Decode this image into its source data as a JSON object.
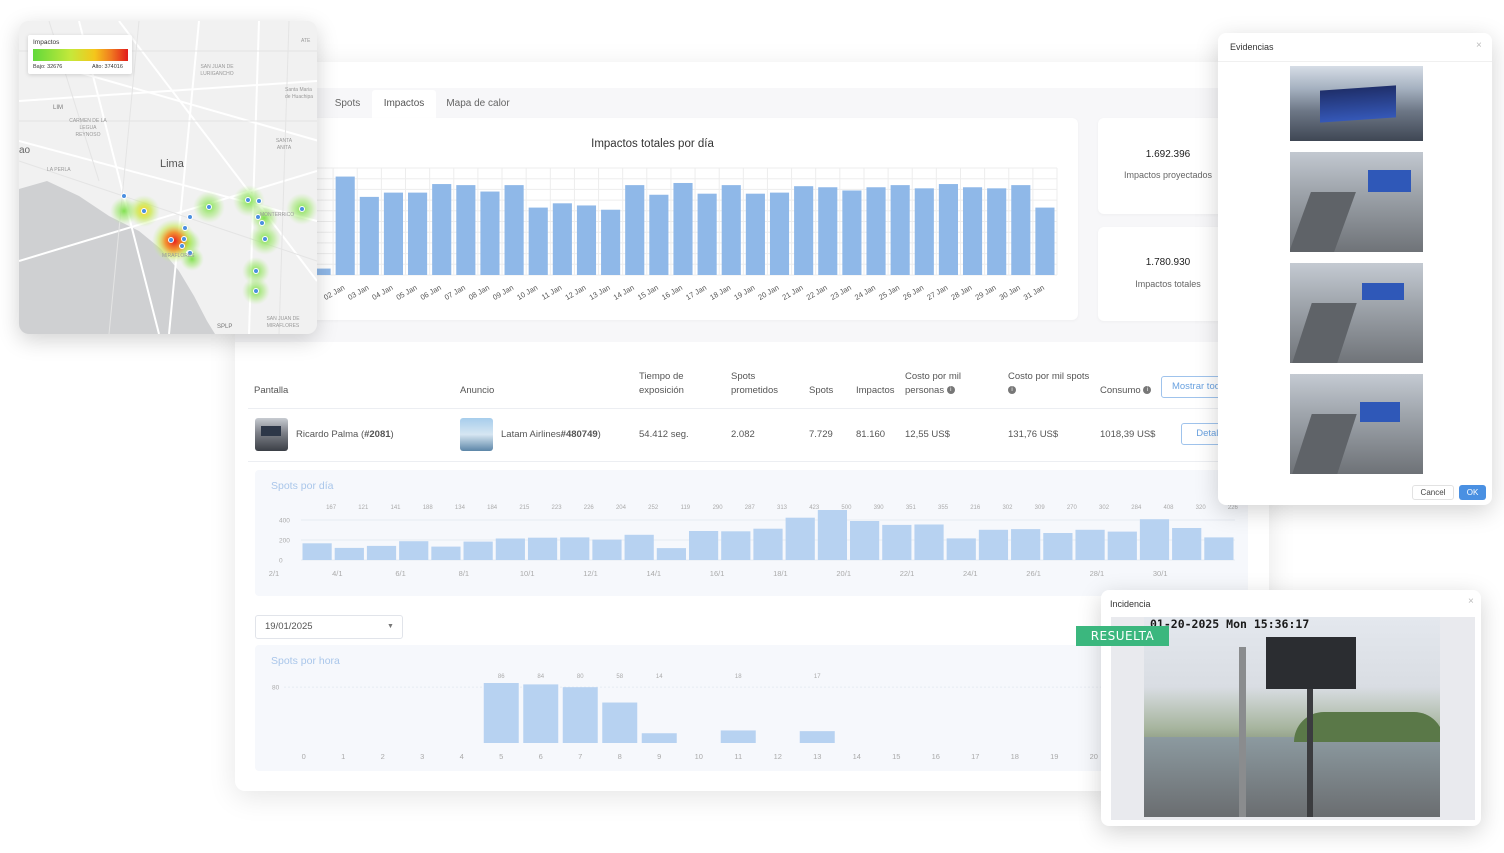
{
  "tabs": [
    {
      "label": "Spots"
    },
    {
      "label": "Impactos"
    },
    {
      "label": "Mapa de calor"
    }
  ],
  "kpis": [
    {
      "value": "1.692.396",
      "label": "Impactos proyectados"
    },
    {
      "value": "1.780.930",
      "label": "Impactos totales"
    }
  ],
  "table": {
    "headers": {
      "pantalla": "Pantalla",
      "anuncio": "Anuncio",
      "tiempo_1": "Tiempo de",
      "tiempo_2": "exposición",
      "prom_1": "Spots",
      "prom_2": "prometidos",
      "spots": "Spots",
      "impactos": "Impactos",
      "costo_p_1": "Costo por mil",
      "costo_p_2": "personas",
      "costo_s": "Costo por mil spots",
      "consumo": "Consumo"
    },
    "show_all_label": "Mostrar tod",
    "row": {
      "pantalla_name": "Ricardo Palma (",
      "pantalla_id": "#2081",
      "pantalla_close": ")",
      "anuncio_name": "Latam Airlines",
      "anuncio_id": "#480749",
      "anuncio_close": ")",
      "tiempo": "54.412 seg.",
      "prometidos": "2.082",
      "spots": "7.729",
      "impactos": "81.160",
      "costo_personas": "12,55 US$",
      "costo_spots": "131,76 US$",
      "consumo": "1018,39 US$",
      "detail_label": "Detalle"
    }
  },
  "date_select": {
    "value": "19/01/2025"
  },
  "map": {
    "legend_title": "Impactos",
    "legend_low": "Bajo: 32676",
    "legend_high": "Alto: 374016",
    "labels": {
      "lima": "Lima",
      "lim": "LIM",
      "ao": "ao",
      "splp": "SPLP",
      "sj_lurigancho": "SAN JUAN DE LURIGANCHO",
      "santa_maria": "Santa Maria de Huachipa",
      "carmen": "CARMEN DE LA LEGUA REYNOSO",
      "santa_anita": "SANTA ANITA",
      "la_perla": "LA PERLA",
      "miraflores": "MIRAFLORES",
      "san_juan_mira": "SAN JUAN DE MIRAFLORES",
      "monterrico": "MONTERRICO",
      "ate": "ATE"
    }
  },
  "evidencias": {
    "title": "Evidencias",
    "cancel": "Cancel",
    "ok": "OK"
  },
  "incidencia": {
    "title": "Incidencia",
    "badge": "RESUELTA",
    "timestamp": "01-20-2025 Mon 15:36:17"
  },
  "colors": {
    "bar": "#8fb8e8",
    "bar_light": "#b7d2f1",
    "accent": "#4a90e2",
    "badge": "#3bb77e"
  },
  "chart_data": [
    {
      "type": "bar",
      "title": "Impactos totales por día",
      "categories": [
        "02 Jan",
        "03 Jan",
        "04 Jan",
        "05 Jan",
        "06 Jan",
        "07 Jan",
        "08 Jan",
        "09 Jan",
        "10 Jan",
        "11 Jan",
        "12 Jan",
        "13 Jan",
        "14 Jan",
        "15 Jan",
        "16 Jan",
        "17 Jan",
        "18 Jan",
        "19 Jan",
        "20 Jan",
        "21 Jan",
        "22 Jan",
        "23 Jan",
        "24 Jan",
        "25 Jan",
        "26 Jan",
        "27 Jan",
        "28 Jan",
        "29 Jan",
        "30 Jan",
        "31 Jan"
      ],
      "values": [
        6,
        92,
        73,
        77,
        77,
        85,
        84,
        78,
        84,
        63,
        67,
        65,
        61,
        84,
        75,
        86,
        76,
        84,
        76,
        77,
        83,
        82,
        79,
        82,
        84,
        81,
        85,
        82,
        81,
        84,
        63
      ],
      "ylim": [
        0,
        100
      ],
      "grid": true
    },
    {
      "type": "bar",
      "title": "Spots por día",
      "categories": [
        "2/1",
        "3/1",
        "4/1",
        "5/1",
        "6/1",
        "7/1",
        "8/1",
        "9/1",
        "10/1",
        "11/1",
        "12/1",
        "13/1",
        "14/1",
        "15/1",
        "16/1",
        "17/1",
        "18/1",
        "19/1",
        "20/1",
        "21/1",
        "22/1",
        "23/1",
        "24/1",
        "25/1",
        "26/1",
        "27/1",
        "28/1",
        "29/1",
        "30/1",
        "31/1"
      ],
      "tick_labels": [
        "2/1",
        "4/1",
        "6/1",
        "8/1",
        "10/1",
        "12/1",
        "14/1",
        "16/1",
        "18/1",
        "20/1",
        "22/1",
        "24/1",
        "26/1",
        "28/1",
        "30/1"
      ],
      "values": [
        167,
        121,
        141,
        188,
        134,
        184,
        215,
        223,
        226,
        204,
        252,
        119,
        290,
        287,
        313,
        423,
        500,
        390,
        351,
        355,
        216,
        302,
        309,
        270,
        302,
        284,
        408,
        320,
        226
      ],
      "data_labels": [
        "167",
        "121",
        "141",
        "188",
        "134",
        "184",
        "215",
        "223",
        "226",
        "204",
        "252",
        "119",
        "290",
        "287",
        "313",
        "423",
        "500",
        "390",
        "351",
        "355",
        "216",
        "302",
        "309",
        "270",
        "302",
        "284",
        "408",
        "320",
        "226"
      ],
      "yticks": [
        0,
        200,
        400
      ],
      "ylim": [
        0,
        500
      ]
    },
    {
      "type": "bar",
      "title": "Spots por hora",
      "categories": [
        "0",
        "1",
        "2",
        "3",
        "4",
        "5",
        "6",
        "7",
        "8",
        "9",
        "10",
        "11",
        "12",
        "13",
        "14",
        "15",
        "16",
        "17",
        "18",
        "19",
        "20"
      ],
      "values": [
        0,
        0,
        0,
        0,
        0,
        86,
        84,
        80,
        58,
        14,
        0,
        18,
        0,
        17,
        0,
        0,
        0,
        0,
        0,
        0,
        0
      ],
      "yticks": [
        80
      ],
      "ylim": [
        0,
        86
      ]
    }
  ]
}
